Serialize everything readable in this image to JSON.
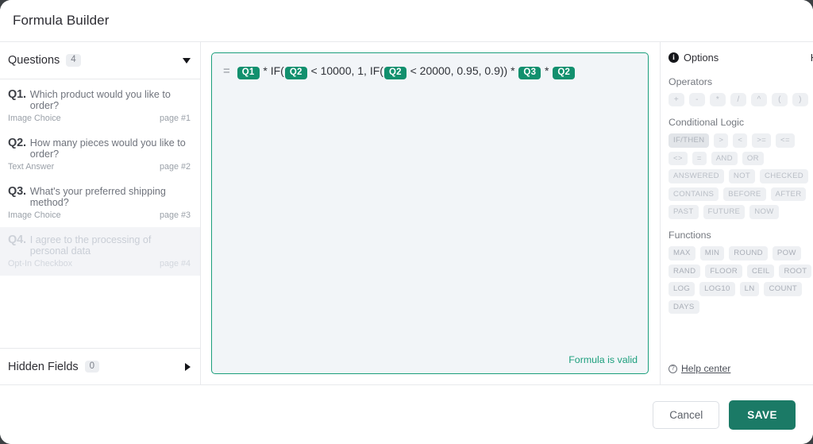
{
  "window": {
    "title": "Formula Builder"
  },
  "sidebar": {
    "questions_section": {
      "label": "Questions",
      "count": "4",
      "expanded": true
    },
    "questions": [
      {
        "num": "Q1.",
        "text": "Which product would you like to order?",
        "type": "Image Choice",
        "page": "page #1",
        "disabled": false
      },
      {
        "num": "Q2.",
        "text": "How many pieces would you like to order?",
        "type": "Text Answer",
        "page": "page #2",
        "disabled": false
      },
      {
        "num": "Q3.",
        "text": "What's your preferred shipping method?",
        "type": "Image Choice",
        "page": "page #3",
        "disabled": false
      },
      {
        "num": "Q4.",
        "text": "I agree to the processing of personal data",
        "type": "Opt-In Checkbox",
        "page": "page #4",
        "disabled": true
      }
    ],
    "hidden_fields_section": {
      "label": "Hidden Fields",
      "count": "0",
      "expanded": false
    }
  },
  "formula": {
    "equals_sign": "=",
    "tokens": [
      {
        "kind": "chip",
        "text": "Q1"
      },
      {
        "kind": "text",
        "text": " * IF("
      },
      {
        "kind": "chip",
        "text": "Q2"
      },
      {
        "kind": "text",
        "text": " < 10000, 1, IF("
      },
      {
        "kind": "chip",
        "text": "Q2"
      },
      {
        "kind": "text",
        "text": " < 20000, 0.95, 0.9)) * "
      },
      {
        "kind": "chip",
        "text": "Q3"
      },
      {
        "kind": "text",
        "text": " * "
      },
      {
        "kind": "chip",
        "text": "Q2"
      }
    ],
    "full_text": "= Q1 * IF( Q2 < 10000, 1, IF( Q2 < 20000, 0.95, 0.9)) * Q3 * Q2",
    "status": "Formula is valid",
    "status_color": "#1b9e7c",
    "border_color": "#1b9e7c"
  },
  "options": {
    "title": "Options",
    "info_icon": "info-icon",
    "history_clipped": "H",
    "groups": [
      {
        "label": "Operators",
        "style": "op",
        "items": [
          "+",
          "-",
          "*",
          "/",
          "^",
          "(",
          ")"
        ]
      },
      {
        "label": "Conditional Logic",
        "style": "cond",
        "items": [
          "IF/THEN",
          ">",
          "<",
          ">=",
          "<=",
          "<>",
          "=",
          "AND",
          "OR",
          "ANSWERED",
          "NOT",
          "CHECKED",
          "CONTAINS",
          "BEFORE",
          "AFTER",
          "PAST",
          "FUTURE",
          "NOW"
        ],
        "active": [
          "IF/THEN"
        ]
      },
      {
        "label": "Functions",
        "style": "fn",
        "items": [
          "MAX",
          "MIN",
          "ROUND",
          "POW",
          "RAND",
          "FLOOR",
          "CEIL",
          "ROOT",
          "LOG",
          "LOG10",
          "LN",
          "COUNT",
          "DAYS"
        ]
      }
    ],
    "help": {
      "label": "Help center",
      "icon": "question-mark-icon"
    }
  },
  "footer": {
    "cancel_label": "Cancel",
    "save_label": "SAVE",
    "save_color": "#1b7a66"
  },
  "theme": {
    "accent": "#12906e",
    "chip_bg": "#12906e",
    "panel_bg": "#f2f5f8"
  }
}
